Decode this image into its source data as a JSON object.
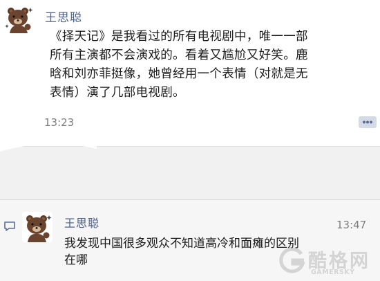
{
  "post": {
    "author": "王思聪",
    "text_lines": [
      "《择天记》是我看过的所有电视剧中，唯一一部",
      "所有主演都不会演戏的。看着又尴尬又好笑。鹿",
      "晗和刘亦菲挺像，她曾经用一个表情（对就是无",
      "表情）演了几部电视剧。"
    ],
    "time": "13:23",
    "avatar_icon": "bear-avatar-icon",
    "comment_icon": "comment-icon"
  },
  "comment": {
    "author": "王思聪",
    "time": "13:47",
    "text_lines": [
      "我发现中国很多观众不知道高冷和面瘫的区别",
      "在哪"
    ],
    "icon": "speech-bubble-icon"
  },
  "watermark": {
    "title": "酷格网",
    "subtitle": "GAMERSKY"
  },
  "colors": {
    "name": "#4b5f87",
    "time": "#7d7d7d",
    "post_bg": "#ffffff",
    "comment_bg": "#f6f6f6"
  }
}
